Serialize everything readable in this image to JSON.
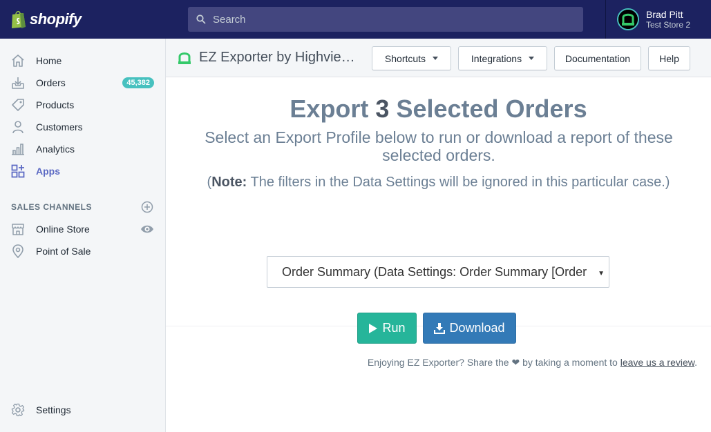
{
  "brand": {
    "name": "shopify"
  },
  "search": {
    "placeholder": "Search"
  },
  "user": {
    "name": "Brad Pitt",
    "store": "Test Store 2"
  },
  "sidebar": {
    "items": [
      {
        "label": "Home",
        "icon": "home-icon"
      },
      {
        "label": "Orders",
        "icon": "orders-icon",
        "badge": "45,382"
      },
      {
        "label": "Products",
        "icon": "tag-icon"
      },
      {
        "label": "Customers",
        "icon": "person-icon"
      },
      {
        "label": "Analytics",
        "icon": "analytics-icon"
      },
      {
        "label": "Apps",
        "icon": "apps-icon",
        "active": true
      }
    ],
    "sales_channels": {
      "title": "SALES CHANNELS",
      "items": [
        {
          "label": "Online Store",
          "icon": "store-icon"
        },
        {
          "label": "Point of Sale",
          "icon": "location-pin-icon"
        }
      ]
    },
    "settings": {
      "label": "Settings",
      "icon": "gear-icon"
    }
  },
  "app_header": {
    "title": "EZ Exporter by Highvie…",
    "buttons": {
      "shortcuts": "Shortcuts",
      "integrations": "Integrations",
      "documentation": "Documentation",
      "help": "Help"
    }
  },
  "export": {
    "heading_pre": "Export ",
    "heading_count": "3",
    "heading_post": " Selected Orders",
    "subheading": "Select an Export Profile below to run or download a report of these selected orders.",
    "note_open": "(",
    "note_label": "Note:",
    "note_text": " The filters in the Data Settings will be ignored in this particular case.)",
    "profile_selected": "Order Summary (Data Settings: Order Summary [Order",
    "run_label": "Run",
    "download_label": "Download"
  },
  "footer": {
    "text_pre": "Enjoying EZ Exporter? Share the ❤ by taking a moment to ",
    "link": "leave us a review",
    "text_post": "."
  },
  "colors": {
    "topbar": "#1c2260",
    "accent": "#5c6ac4",
    "badge": "#47c1bf",
    "run": "#26b59a",
    "download": "#337ab7"
  }
}
